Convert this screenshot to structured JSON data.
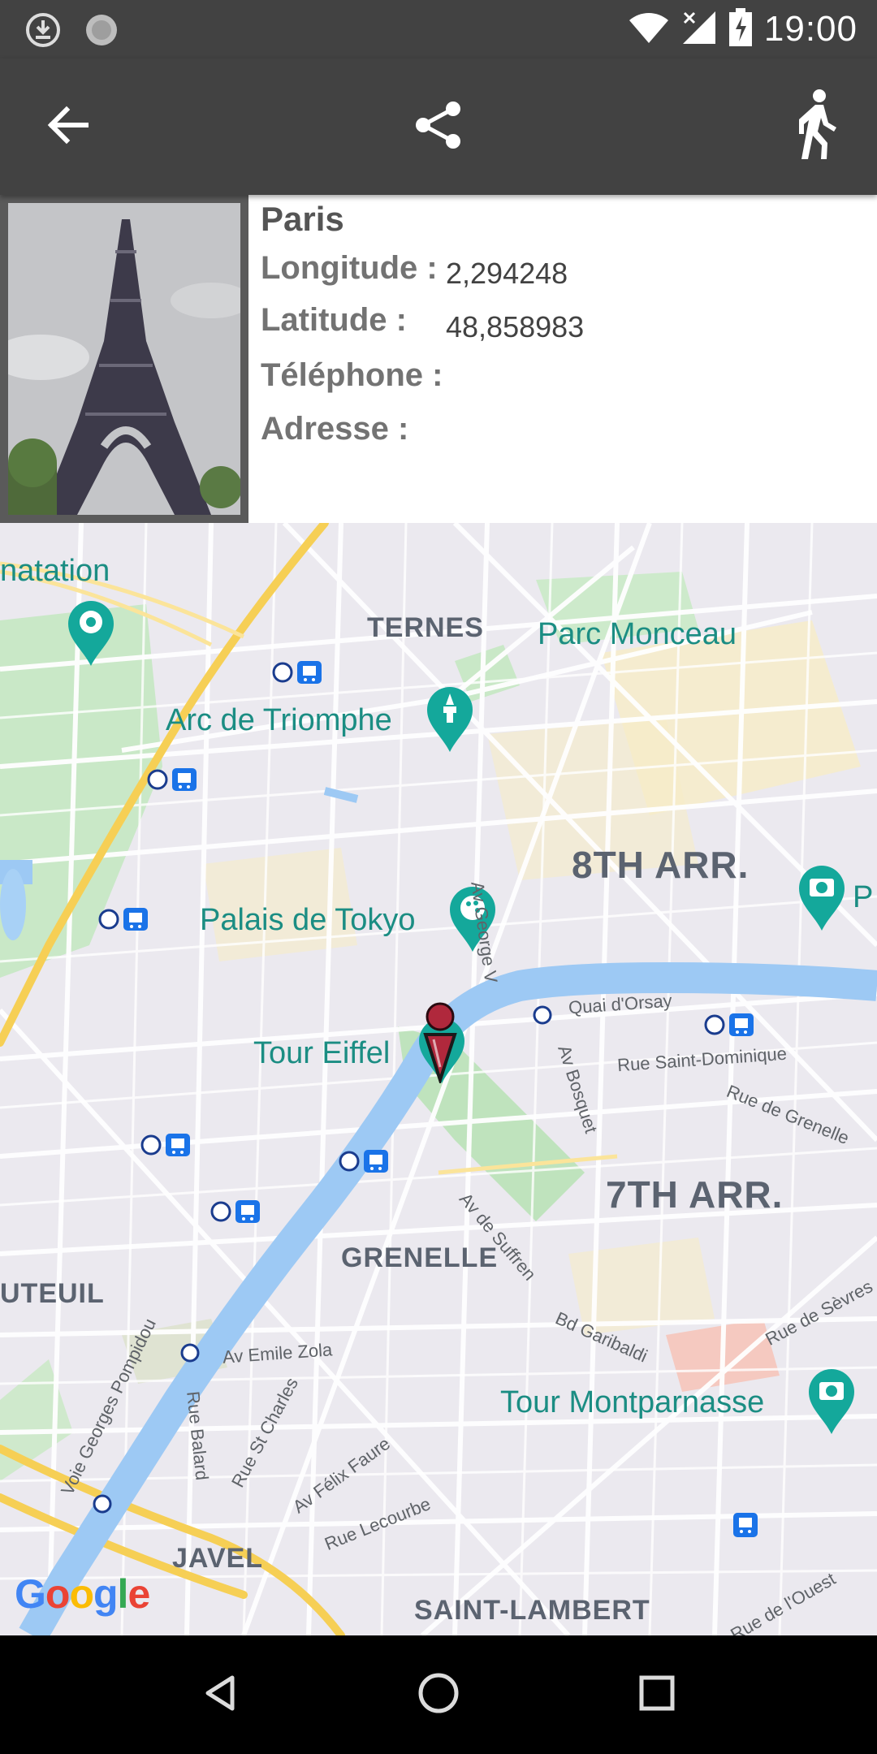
{
  "status_bar": {
    "time": "19:00",
    "icons": [
      "download-icon",
      "sync-icon",
      "wifi-icon",
      "signal-icon",
      "battery-charging-icon"
    ]
  },
  "action_bar": {
    "icons": [
      "back-arrow-icon",
      "share-icon",
      "pedestrian-icon"
    ]
  },
  "place": {
    "name": "Paris",
    "longitude_label": "Longitude :",
    "longitude_value": "2,294248",
    "latitude_label": "Latitude :",
    "latitude_value": "48,858983",
    "telephone_label": "Téléphone :",
    "telephone_value": "",
    "address_label": "Adresse :",
    "address_value": ""
  },
  "map": {
    "pois": {
      "acclimatation": "natation",
      "arc": "Arc de Triomphe",
      "monceau": "Parc Monceau",
      "tokyo": "Palais de Tokyo",
      "eiffel": "Tour Eiffel",
      "montparnasse": "Tour Montparnasse",
      "partial_p": "P"
    },
    "districts": {
      "ternes": "TERNES",
      "grenelle": "GRENELLE",
      "auteuil": "UTEUIL",
      "javel": "JAVEL",
      "saint_lambert": "SAINT-LAMBERT",
      "arr8": "8TH ARR.",
      "arr7": "7TH ARR."
    },
    "streets": {
      "george_v": "Av George V",
      "quai_orsay": "Quai d'Orsay",
      "bosquet": "Av Bosquet",
      "saint_dominique": "Rue Saint-Dominique",
      "grenelle": "Rue de Grenelle",
      "suffren": "Av de Suffren",
      "sevres": "Rue de Sèvres",
      "garibaldi": "Bd Garibaldi",
      "emile_zola": "Av Emile Zola",
      "pompidou": "Voie Georges Pompidou",
      "balard": "Rue Balard",
      "st_charles": "Rue St Charles",
      "felix_faure": "Av Félix Faure",
      "lecourbe": "Rue Lecourbe",
      "ouest": "Rue de l'Ouest"
    },
    "attribution": "Google",
    "marker_icon": "location-pin-icon"
  },
  "nav_bar": {
    "icons": [
      "nav-back-icon",
      "nav-home-icon",
      "nav-recents-icon"
    ]
  }
}
